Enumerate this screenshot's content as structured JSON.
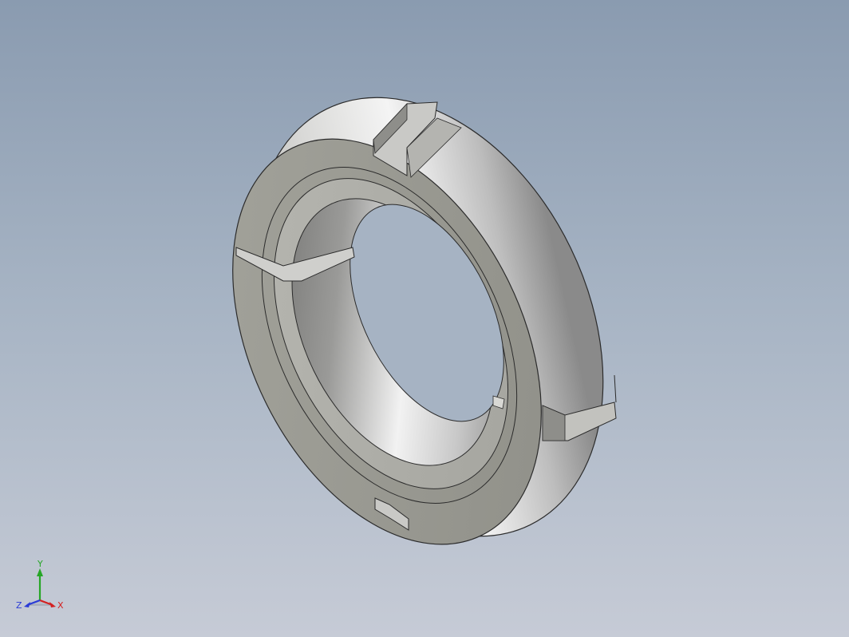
{
  "viewport": {
    "background_top": "#8a9bb0",
    "background_bottom": "#c6cbd6"
  },
  "model": {
    "part": "slotted-lock-nut",
    "face_color": "#9a9a92",
    "edge_color": "#2b2b2b"
  },
  "triad": {
    "y_label": "Y",
    "x_label": "X",
    "z_label": "Z",
    "y_color": "#26a626",
    "x_color": "#d42020",
    "z_color": "#2a3bd6"
  }
}
